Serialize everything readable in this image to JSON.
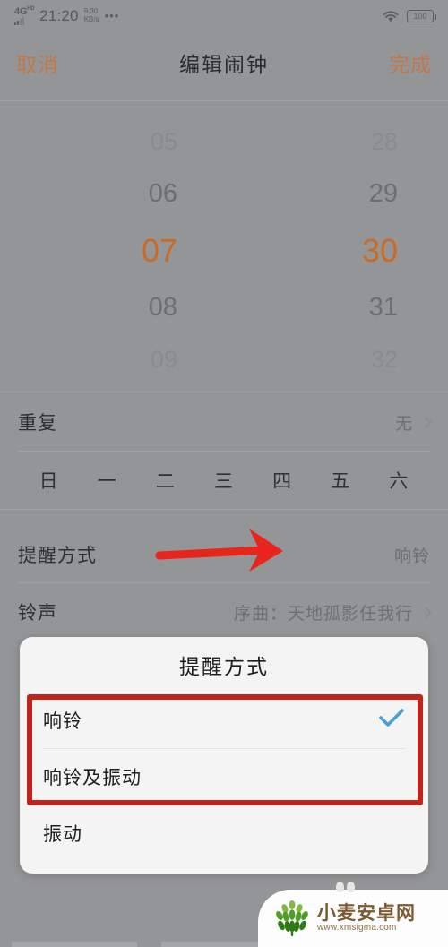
{
  "status_bar": {
    "network": "4G",
    "network_sup": "HD",
    "time": "21:20",
    "rate_value": "9.30",
    "rate_unit": "KB/s",
    "overflow": "•••",
    "wifi_icon": "wifi-icon",
    "battery": "100"
  },
  "nav": {
    "cancel": "取消",
    "title": "编辑闹钟",
    "done": "完成"
  },
  "time_picker": {
    "hours": [
      "05",
      "06",
      "07",
      "08",
      "09"
    ],
    "minutes": [
      "28",
      "29",
      "30",
      "31",
      "32"
    ],
    "selected_hour": "07",
    "selected_minute": "30",
    "accent_color": "#c96b25"
  },
  "rows": {
    "repeat": {
      "label": "重复",
      "value": "无"
    },
    "alert_mode": {
      "label": "提醒方式",
      "value": "响铃"
    },
    "ringtone": {
      "label": "铃声",
      "value": "序曲：天地孤影任我行"
    }
  },
  "weekdays": [
    "日",
    "一",
    "二",
    "三",
    "四",
    "五",
    "六"
  ],
  "dialog": {
    "title": "提醒方式",
    "options": [
      {
        "label": "响铃",
        "checked": true
      },
      {
        "label": "响铃及振动",
        "checked": false
      },
      {
        "label": "振动",
        "checked": false
      }
    ],
    "check_color": "#4a9fd8",
    "highlight_color": "#c1241b"
  },
  "annotation": {
    "arrow_color": "#e8251c"
  },
  "watermark": {
    "name": "小麦安卓网",
    "url": "www.xmsigma.com"
  }
}
